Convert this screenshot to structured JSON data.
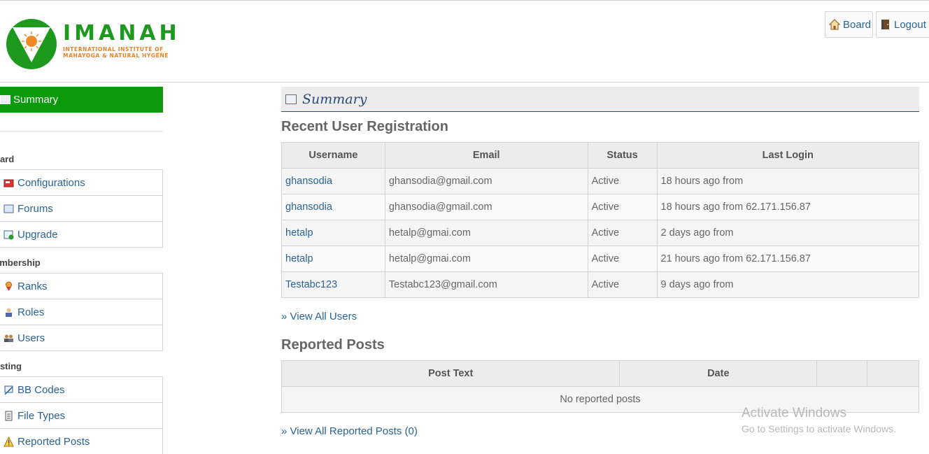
{
  "header": {
    "logo_name": "IMANAH",
    "logo_sub1": "INTERNATIONAL INSTITUTE OF",
    "logo_sub2": "MAHAYOGA & NATURAL HYGENE",
    "board_label": "Board",
    "logout_label": "Logout"
  },
  "sidebar": {
    "active_label": "Summary",
    "section_board": "oard",
    "section_membership": "embership",
    "section_posting": "osting",
    "items": [
      {
        "label": "Configurations",
        "icon": "configurations-icon"
      },
      {
        "label": "Forums",
        "icon": "forums-icon"
      },
      {
        "label": "Upgrade",
        "icon": "upgrade-icon"
      },
      {
        "label": "Ranks",
        "icon": "ranks-icon"
      },
      {
        "label": "Roles",
        "icon": "roles-icon"
      },
      {
        "label": "Users",
        "icon": "users-icon"
      },
      {
        "label": "BB Codes",
        "icon": "bbcodes-icon"
      },
      {
        "label": "File Types",
        "icon": "filetypes-icon"
      },
      {
        "label": "Reported Posts",
        "icon": "warning-icon"
      }
    ]
  },
  "main": {
    "title": "Summary",
    "users_heading": "Recent User Registration",
    "users_columns": [
      "Username",
      "Email",
      "Status",
      "Last Login"
    ],
    "users_rows": [
      {
        "username": "ghansodia",
        "email": "ghansodia@gmail.com",
        "status": "Active",
        "last_login": "18 hours ago from"
      },
      {
        "username": "ghansodia",
        "email": "ghansodia@gmail.com",
        "status": "Active",
        "last_login": "18 hours ago from 62.171.156.87"
      },
      {
        "username": "hetalp",
        "email": "hetalp@gmai.com",
        "status": "Active",
        "last_login": "2 days ago from"
      },
      {
        "username": "hetalp",
        "email": "hetalp@gmai.com",
        "status": "Active",
        "last_login": "21 hours ago from 62.171.156.87"
      },
      {
        "username": "Testabc123",
        "email": "Testabc123@gmail.com",
        "status": "Active",
        "last_login": "9 days ago from"
      }
    ],
    "view_all_users": "» View All Users",
    "posts_heading": "Reported Posts",
    "posts_columns": [
      "Post Text",
      "Date",
      "",
      ""
    ],
    "posts_empty": "No reported posts",
    "view_all_posts": "» View All Reported Posts (0)"
  },
  "watermark": {
    "line1": "Activate Windows",
    "line2": "Go to Settings to activate Windows."
  },
  "colors": {
    "brand_green": "#0a9a0a",
    "link_blue": "#2a6496",
    "logo_orange": "#e6832a"
  }
}
